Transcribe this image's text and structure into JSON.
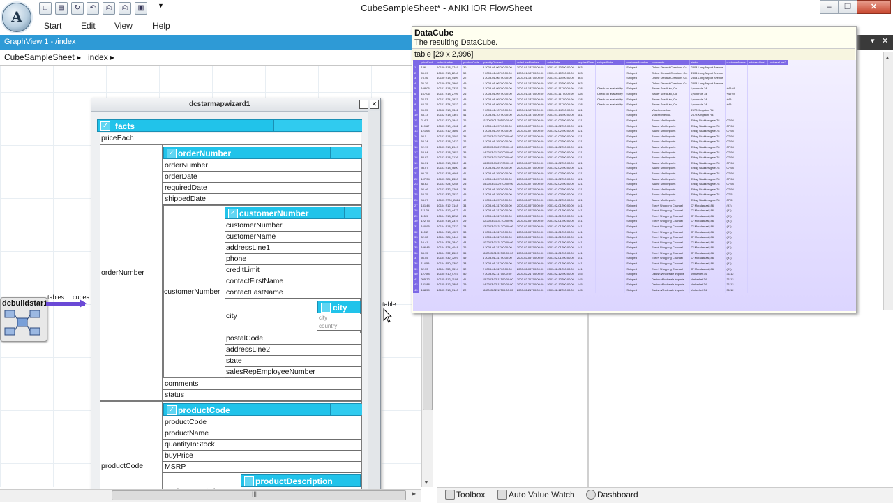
{
  "window": {
    "title": "CubeSampleSheet* - ANKHOR FlowSheet",
    "logo_letter": "A"
  },
  "quick_access": [
    {
      "icon": "new-file-icon",
      "glyph": "□"
    },
    {
      "icon": "open-file-icon",
      "glyph": "▤"
    },
    {
      "icon": "redo-icon",
      "glyph": "↻"
    },
    {
      "icon": "undo-icon",
      "glyph": "↶"
    },
    {
      "icon": "print-icon",
      "glyph": "⎙"
    },
    {
      "icon": "print-preview-icon",
      "glyph": "⎙"
    },
    {
      "icon": "camera-icon",
      "glyph": "▣"
    },
    {
      "icon": "customize-arrow-icon",
      "glyph": "▼"
    }
  ],
  "window_controls": {
    "minimize": "–",
    "restore": "❐",
    "close": "✕"
  },
  "menu": [
    "Start",
    "Edit",
    "View",
    "Help"
  ],
  "graph_view": {
    "header": "GraphView 1 - /index",
    "breadcrumb": [
      "CubeSampleSheet ▸",
      "index ▸"
    ]
  },
  "node": {
    "label": "dcbuildstar1",
    "port_in": "tables",
    "port_out": "cubes",
    "port_wizard": "table"
  },
  "wizard": {
    "title": "dcstarmapwizard1",
    "facts": {
      "label": "facts",
      "check": "✓"
    },
    "priceEach": "priceEach",
    "orderNumber_group": "orderNumber",
    "orderNumber_hdr": "orderNumber",
    "order_fields": [
      "orderNumber",
      "orderDate",
      "requiredDate",
      "shippedDate"
    ],
    "customerNumber_group": "customerNumber",
    "customerNumber_hdr": "customerNumber",
    "customer_fields": [
      "customerNumber",
      "customerName",
      "addressLine1",
      "phone",
      "creditLimit",
      "contactFirstName",
      "contactLastName"
    ],
    "city_group": "city",
    "city_hdr": "city",
    "city_fields": [
      "city",
      "country"
    ],
    "customer_fields2": [
      "postalCode",
      "addressLine2",
      "state",
      "salesRepEmployeeNumber"
    ],
    "order_fields2": [
      "comments",
      "status"
    ],
    "productCode_group": "productCode",
    "productCode_hdr": "productCode",
    "product_fields": [
      "productCode",
      "productName",
      "quantityInStock",
      "buyPrice",
      "MSRP"
    ],
    "productDescription_hdr": "productDescription",
    "cut_field": "productDescription"
  },
  "tooltip": {
    "title": "DataCube",
    "subtitle": "The resulting DataCube.",
    "table_label": "table [29 x 2,996]",
    "columns": [
      "",
      "priceEach",
      "orderNumber",
      "productCode",
      "quantityOrdered",
      "orderLineNumber",
      "orderDate",
      "requiredDate",
      "shippedDate",
      "customerNumber",
      "comments",
      "status",
      "customerName",
      "addressLine1",
      "addressLine2"
    ],
    "rows": [
      [
        "1",
        "136",
        "10100 S18_1749",
        "30",
        "3 2003-01-06T00:00:00",
        "2003-01-13T00:00:00",
        "2003-01-10T00:00:00",
        "363",
        "",
        "Shipped",
        "Online Diecast Creations Co.",
        "2304 Long Airport Avenue",
        ""
      ],
      [
        "2",
        "55.09",
        "10100 S18_2248",
        "50",
        "2 2003-01-06T00:00:00",
        "2003-01-13T00:00:00",
        "2003-01-10T00:00:00",
        "363",
        "",
        "Shipped",
        "Online Diecast Creations Co.",
        "2304 Long Airport Avenue",
        ""
      ],
      [
        "3",
        "75.46",
        "10100 S18_4409",
        "22",
        "4 2003-01-06T00:00:00",
        "2003-01-13T00:00:00",
        "2003-01-10T00:00:00",
        "363",
        "",
        "Shipped",
        "Online Diecast Creations Co.",
        "2304 Long Airport Avenue",
        ""
      ],
      [
        "4",
        "35.29",
        "10100 S24_3969",
        "49",
        "1 2003-01-06T00:00:00",
        "2003-01-13T00:00:00",
        "2003-01-10T00:00:00",
        "363",
        "",
        "Shipped",
        "Online Diecast Creations Co.",
        "2304 Long Airport Avenue",
        ""
      ],
      [
        "5",
        "108.06",
        "10101 S18_2325",
        "25",
        "4 2003-01-09T00:00:00",
        "2003-01-18T00:00:00",
        "2003-01-11T00:00:00",
        "128",
        "Check on availability.",
        "Shipped",
        "Blauer See Auto, Co.",
        "Lyonerstr. 34",
        "+49 69"
      ],
      [
        "6",
        "167.06",
        "10101 S18_2795",
        "26",
        "1 2003-01-09T00:00:00",
        "2003-01-18T00:00:00",
        "2003-01-11T00:00:00",
        "128",
        "Check on availability.",
        "Shipped",
        "Blauer See Auto, Co.",
        "Lyonerstr. 34",
        "+49 69"
      ],
      [
        "7",
        "32.53",
        "10101 S24_1937",
        "45",
        "3 2003-01-09T00:00:00",
        "2003-01-18T00:00:00",
        "2003-01-11T00:00:00",
        "128",
        "Check on availability.",
        "Shipped",
        "Blauer See Auto, Co.",
        "Lyonerstr. 34",
        "+49"
      ],
      [
        "8",
        "44.35",
        "10101 S24_2022",
        "46",
        "2 2003-01-09T00:00:00",
        "2003-01-18T00:00:00",
        "2003-01-11T00:00:00",
        "128",
        "Check on availability.",
        "Shipped",
        "Blauer See Auto, Co.",
        "Lyonerstr. 34",
        "+49"
      ],
      [
        "9",
        "95.55",
        "10102 S18_1342",
        "39",
        "2 2003-01-10T00:00:00",
        "2003-01-18T00:00:00",
        "2003-01-14T00:00:00",
        "181",
        "",
        "Shipped",
        "Vitachrome Inc.",
        "2678 Kingston Rd.",
        ""
      ],
      [
        "10",
        "43.13",
        "10102 S18_1367",
        "41",
        "1 2003-01-10T00:00:00",
        "2003-01-18T00:00:00",
        "2003-01-14T00:00:00",
        "181",
        "",
        "Shipped",
        "Vitachrome Inc.",
        "2678 Kingston Rd.",
        ""
      ],
      [
        "11",
        "214.3",
        "10103 S10_1949",
        "26",
        "11 2003-01-29T00:00:00",
        "2003-02-07T00:00:00",
        "2003-02-02T00:00:00",
        "121",
        "",
        "Shipped",
        "Baane Mini Imports",
        "Erling Skakkes gate 78",
        "07-98"
      ],
      [
        "12",
        "119.67",
        "10103 S10_4962",
        "42",
        "4 2003-01-29T00:00:00",
        "2003-02-07T00:00:00",
        "2003-02-02T00:00:00",
        "121",
        "",
        "Shipped",
        "Baane Mini Imports",
        "Erling Skakkes gate 78",
        "07-98"
      ],
      [
        "13",
        "121.64",
        "10103 S12_1666",
        "27",
        "8 2003-01-29T00:00:00",
        "2003-02-07T00:00:00",
        "2003-02-02T00:00:00",
        "121",
        "",
        "Shipped",
        "Baane Mini Imports",
        "Erling Skakkes gate 78",
        "07-98"
      ],
      [
        "14",
        "94.5",
        "10103 S18_1097",
        "35",
        "10 2003-01-29T00:00:00",
        "2003-02-07T00:00:00",
        "2003-02-02T00:00:00",
        "121",
        "",
        "Shipped",
        "Baane Mini Imports",
        "Erling Skakkes gate 78",
        "07-98"
      ],
      [
        "15",
        "58.34",
        "10103 S18_2432",
        "22",
        "2 2003-01-29T00:00:00",
        "2003-02-07T00:00:00",
        "2003-02-02T00:00:00",
        "121",
        "",
        "Shipped",
        "Baane Mini Imports",
        "Erling Skakkes gate 78",
        "07-98"
      ],
      [
        "16",
        "92.19",
        "10103 S18_2949",
        "27",
        "12 2003-01-29T00:00:00",
        "2003-02-07T00:00:00",
        "2003-02-02T00:00:00",
        "121",
        "",
        "Shipped",
        "Baane Mini Imports",
        "Erling Skakkes gate 78",
        "07-98"
      ],
      [
        "17",
        "63.84",
        "10103 S18_2957",
        "35",
        "14 2003-01-29T00:00:00",
        "2003-02-07T00:00:00",
        "2003-02-02T00:00:00",
        "121",
        "",
        "Shipped",
        "Baane Mini Imports",
        "Erling Skakkes gate 78",
        "07-98"
      ],
      [
        "18",
        "88.92",
        "10103 S18_3136",
        "25",
        "13 2003-01-29T00:00:00",
        "2003-02-07T00:00:00",
        "2003-02-02T00:00:00",
        "121",
        "",
        "Shipped",
        "Baane Mini Imports",
        "Erling Skakkes gate 78",
        "07-98"
      ],
      [
        "19",
        "86.31",
        "10103 S18_3320",
        "46",
        "16 2003-01-29T00:00:00",
        "2003-02-07T00:00:00",
        "2003-02-02T00:00:00",
        "121",
        "",
        "Shipped",
        "Baane Mini Imports",
        "Erling Skakkes gate 78",
        "07-98"
      ],
      [
        "20",
        "98.07",
        "10103 S18_4600",
        "36",
        "5 2003-01-29T00:00:00",
        "2003-02-07T00:00:00",
        "2003-02-02T00:00:00",
        "121",
        "",
        "Shipped",
        "Baane Mini Imports",
        "Erling Skakkes gate 78",
        "07-98"
      ],
      [
        "21",
        "40.75",
        "10103 S18_4668",
        "41",
        "9 2003-01-29T00:00:00",
        "2003-02-07T00:00:00",
        "2003-02-02T00:00:00",
        "121",
        "",
        "Shipped",
        "Baane Mini Imports",
        "Erling Skakkes gate 78",
        "07-98"
      ],
      [
        "22",
        "107.34",
        "10103 S24_2300",
        "36",
        "1 2003-01-29T00:00:00",
        "2003-02-07T00:00:00",
        "2003-02-02T00:00:00",
        "121",
        "",
        "Shipped",
        "Baane Mini Imports",
        "Erling Skakkes gate 78",
        "07-98"
      ],
      [
        "23",
        "88.62",
        "10103 S24_4258",
        "25",
        "15 2003-01-29T00:00:00",
        "2003-02-07T00:00:00",
        "2003-02-02T00:00:00",
        "121",
        "",
        "Shipped",
        "Baane Mini Imports",
        "Erling Skakkes gate 78",
        "07-98"
      ],
      [
        "24",
        "92.46",
        "10103 S32_1268",
        "31",
        "3 2003-01-29T00:00:00",
        "2003-02-07T00:00:00",
        "2003-02-02T00:00:00",
        "121",
        "",
        "Shipped",
        "Baane Mini Imports",
        "Erling Skakkes gate 78",
        "07-98"
      ],
      [
        "25",
        "63.35",
        "10103 S32_3522",
        "45",
        "7 2003-01-29T00:00:00",
        "2003-02-07T00:00:00",
        "2003-02-02T00:00:00",
        "121",
        "",
        "Shipped",
        "Baane Mini Imports",
        "Erling Skakkes gate 78",
        "07-5"
      ],
      [
        "26",
        "94.07",
        "10103 S700_2824",
        "42",
        "6 2003-01-29T00:00:00",
        "2003-02-07T00:00:00",
        "2003-02-02T00:00:00",
        "121",
        "",
        "Shipped",
        "Baane Mini Imports",
        "Erling Skakkes gate 78",
        "07-5"
      ],
      [
        "27",
        "131.44",
        "10104 S12_3148",
        "34",
        "1 2003-01-31T00:00:00",
        "2003-02-09T00:00:00",
        "2003-02-01T00:00:00",
        "141",
        "",
        "Shipped",
        "Euro+ Shopping Channel",
        "C/ Moralzarzal, 86",
        "(91)"
      ],
      [
        "28",
        "111.39",
        "10104 S12_4473",
        "41",
        "9 2003-01-31T00:00:00",
        "2003-02-09T00:00:00",
        "2003-02-01T00:00:00",
        "141",
        "",
        "Shipped",
        "Euro+ Shopping Channel",
        "C/ Moralzarzal, 86",
        "(91)"
      ],
      [
        "29",
        "115.9",
        "10104 S18_2238",
        "24",
        "8 2003-01-31T00:00:00",
        "2003-02-09T00:00:00",
        "2003-02-01T00:00:00",
        "141",
        "",
        "Shipped",
        "Euro+ Shopping Channel",
        "C/ Moralzarzal, 86",
        "(91)"
      ],
      [
        "30",
        "122.73",
        "10104 S18_2319",
        "29",
        "12 2003-01-31T00:00:00",
        "2003-02-09T00:00:00",
        "2003-02-01T00:00:00",
        "141",
        "",
        "Shipped",
        "Euro+ Shopping Channel",
        "C/ Moralzarzal, 86",
        "(91)"
      ],
      [
        "31",
        "160.95",
        "10104 S18_3232",
        "23",
        "13 2003-01-31T00:00:00",
        "2003-02-09T00:00:00",
        "2003-02-01T00:00:00",
        "141",
        "",
        "Shipped",
        "Euro+ Shopping Channel",
        "C/ Moralzarzal, 86",
        "(91)"
      ],
      [
        "32",
        "110.2",
        "10104 S18_4027",
        "38",
        "3 2003-01-31T00:00:00",
        "2003-02-09T00:00:00",
        "2003-02-01T00:00:00",
        "141",
        "",
        "Shipped",
        "Euro+ Shopping Channel",
        "C/ Moralzarzal, 86",
        "(91)"
      ],
      [
        "33",
        "52.02",
        "10104 S24_1444",
        "35",
        "6 2003-01-31T00:00:00",
        "2003-02-09T00:00:00",
        "2003-02-01T00:00:00",
        "141",
        "",
        "Shipped",
        "Euro+ Shopping Channel",
        "C/ Moralzarzal, 86",
        "(91)"
      ],
      [
        "34",
        "10.41",
        "10104 S24_2840",
        "44",
        "10 2003-01-31T00:00:00",
        "2003-02-09T00:00:00",
        "2003-02-01T00:00:00",
        "141",
        "",
        "Shipped",
        "Euro+ Shopping Channel",
        "C/ Moralzarzal, 86",
        "(91)"
      ],
      [
        "35",
        "106.45",
        "10104 S24_4048",
        "26",
        "5 2003-01-31T00:00:00",
        "2003-02-09T00:00:00",
        "2003-02-01T00:00:00",
        "141",
        "",
        "Shipped",
        "Euro+ Shopping Channel",
        "C/ Moralzarzal, 86",
        "(91)"
      ],
      [
        "36",
        "53.95",
        "10104 S32_2509",
        "35",
        "11 2003-01-31T00:00:00",
        "2003-02-09T00:00:00",
        "2003-02-01T00:00:00",
        "141",
        "",
        "Shipped",
        "Euro+ Shopping Channel",
        "C/ Moralzarzal, 86",
        "(91)"
      ],
      [
        "37",
        "56.55",
        "10104 S32_3207",
        "49",
        "4 2003-01-31T00:00:00",
        "2003-02-09T00:00:00",
        "2003-02-01T00:00:00",
        "141",
        "",
        "Shipped",
        "Euro+ Shopping Channel",
        "C/ Moralzarzal, 86",
        "(91)"
      ],
      [
        "38",
        "114.59",
        "10104 S50_1392",
        "33",
        "7 2003-01-31T00:00:00",
        "2003-02-09T00:00:00",
        "2003-02-01T00:00:00",
        "141",
        "",
        "Shipped",
        "Euro+ Shopping Channel",
        "C/ Moralzarzal, 86",
        "(91)"
      ],
      [
        "39",
        "52.33",
        "10104 S50_1514",
        "32",
        "2 2003-01-31T00:00:00",
        "2003-02-09T00:00:00",
        "2003-02-01T00:00:00",
        "141",
        "",
        "Shipped",
        "Euro+ Shopping Channel",
        "C/ Moralzarzal, 86",
        "(91)"
      ],
      [
        "40",
        "127.84",
        "10105 S10_4757",
        "50",
        "2 2003-02-11T00:00:00",
        "2003-02-21T00:00:00",
        "2003-02-12T00:00:00",
        "145",
        "",
        "Shipped",
        "Danish Wholesale Imports",
        "Vinbæltet 34",
        "31 12"
      ],
      [
        "41",
        "205.72",
        "10105 S12_1108",
        "41",
        "15 2003-02-11T00:00:00",
        "2003-02-21T00:00:00",
        "2003-02-12T00:00:00",
        "145",
        "",
        "Shipped",
        "Danish Wholesale Imports",
        "Vinbæltet 34",
        "31 12"
      ],
      [
        "42",
        "141.88",
        "10105 S12_3891",
        "29",
        "14 2003-02-11T00:00:00",
        "2003-02-21T00:00:00",
        "2003-02-12T00:00:00",
        "145",
        "",
        "Shipped",
        "Danish Wholesale Imports",
        "Vinbæltet 34",
        "31 12"
      ],
      [
        "43",
        "138.59",
        "10105 S18_3140",
        "22",
        "11 2003-02-11T00:00:00",
        "2003-02-21T00:00:00",
        "2003-02-12T00:00:00",
        "145",
        "",
        "Shipped",
        "Danish Wholesale Imports",
        "Vinbæltet 34",
        "31 12"
      ]
    ]
  },
  "bottom_tabs": [
    "Toolbox",
    "Auto Value Watch",
    "Dashboard"
  ],
  "scroll": {
    "hscroll_grip": "|||",
    "vscroll_down": "▼",
    "vscroll_up": "▲",
    "hscroll_right": "▶"
  },
  "colors": {
    "accent": "#2e9ad6",
    "header_cyan": "#21c3ea",
    "connector": "#6a49d6",
    "table_header": "#7c68e6"
  }
}
